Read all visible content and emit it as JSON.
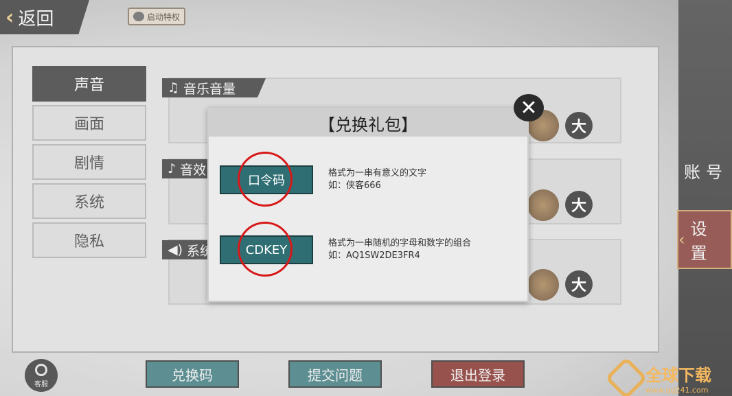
{
  "top_bar": {
    "back_label": "返回",
    "privilege_label": "启动特权"
  },
  "settings_menu": [
    {
      "label": "声音",
      "active": true
    },
    {
      "label": "画面",
      "active": false
    },
    {
      "label": "剧情",
      "active": false
    },
    {
      "label": "系统",
      "active": false
    },
    {
      "label": "隐私",
      "active": false
    }
  ],
  "sound_sections": {
    "music_label": "音乐音量",
    "effects_label": "音效",
    "system_label": "系统",
    "max_label": "大"
  },
  "right_sidebar": {
    "account_tab": "账号",
    "settings_tab": "设置"
  },
  "bottom_bar": {
    "service_label": "客服",
    "redeem_code_button": "兑换码",
    "submit_issue_button": "提交问题",
    "logout_button": "退出登录"
  },
  "modal": {
    "title": "【兑换礼包】",
    "password_button": "口令码",
    "password_desc_line1": "格式为一串有意义的文字",
    "password_desc_line2": "如：侠客666",
    "cdkey_button": "CDKEY",
    "cdkey_desc_line1": "格式为一串随机的字母和数字的组合",
    "cdkey_desc_line2": "如：AQ1SW2DE3FR4"
  },
  "watermark": {
    "title": "全球下载",
    "url": "www.qq241.com"
  },
  "colors": {
    "teal": "#2f6f74",
    "dark_red": "#7b221c",
    "highlight_red": "#d81818",
    "watermark_orange": "#f2a532"
  }
}
